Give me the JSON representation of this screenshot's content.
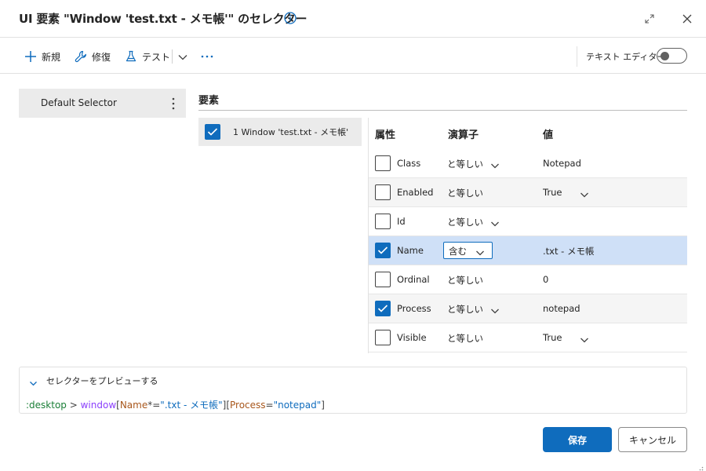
{
  "dialog": {
    "title": "UI 要素 \"Window 'test.txt - メモ帳'\" のセレクター"
  },
  "toolbar": {
    "new_label": "新規",
    "repair_label": "修復",
    "test_label": "テスト",
    "text_editor_label": "テキスト エディター",
    "text_editor_on": false
  },
  "selectors": {
    "items": [
      {
        "label": "Default Selector"
      }
    ]
  },
  "elements": {
    "title": "要素",
    "items": [
      {
        "label": "1   Window 'test.txt - メモ帳'",
        "checked": true
      }
    ]
  },
  "attributes": {
    "headers": {
      "attribute": "属性",
      "operator": "演算子",
      "value": "値"
    },
    "rows": [
      {
        "name": "Class",
        "checked": false,
        "operator": "と等しい",
        "value": "Notepad",
        "value_dropdown": false,
        "op_dropdown": true
      },
      {
        "name": "Enabled",
        "checked": false,
        "operator": "と等しい",
        "value": "True",
        "value_dropdown": true,
        "op_dropdown": false
      },
      {
        "name": "Id",
        "checked": false,
        "operator": "と等しい",
        "value": "",
        "value_dropdown": false,
        "op_dropdown": true
      },
      {
        "name": "Name",
        "checked": true,
        "operator": "含む",
        "value": ".txt - メモ帳",
        "value_dropdown": false,
        "op_dropdown": true,
        "selected": true
      },
      {
        "name": "Ordinal",
        "checked": false,
        "operator": "と等しい",
        "value": "0",
        "value_dropdown": false,
        "op_dropdown": false
      },
      {
        "name": "Process",
        "checked": true,
        "operator": "と等しい",
        "value": "notepad",
        "value_dropdown": false,
        "op_dropdown": true
      },
      {
        "name": "Visible",
        "checked": false,
        "operator": "と等しい",
        "value": "True",
        "value_dropdown": true,
        "op_dropdown": false
      }
    ]
  },
  "preview": {
    "label": "セレクターをプレビューする",
    "code": {
      "desktop": ":desktop",
      "gt": " > ",
      "window": "window",
      "open1": "[",
      "attr1": "Name",
      "op1": "*=",
      "val1": "\".txt - メモ帳\"",
      "close1": "]",
      "open2": "[",
      "attr2": "Process",
      "op2": "=",
      "val2": "\"notepad\"",
      "close2": "]"
    }
  },
  "footer": {
    "save_label": "保存",
    "cancel_label": "キャンセル"
  },
  "colors": {
    "accent": "#0f6cbd",
    "selected_row": "#cfe0f7",
    "code_green": "#1a7f37",
    "code_purple": "#8a3ffc",
    "code_brown": "#a8571c",
    "code_blue": "#0f6cbd"
  }
}
